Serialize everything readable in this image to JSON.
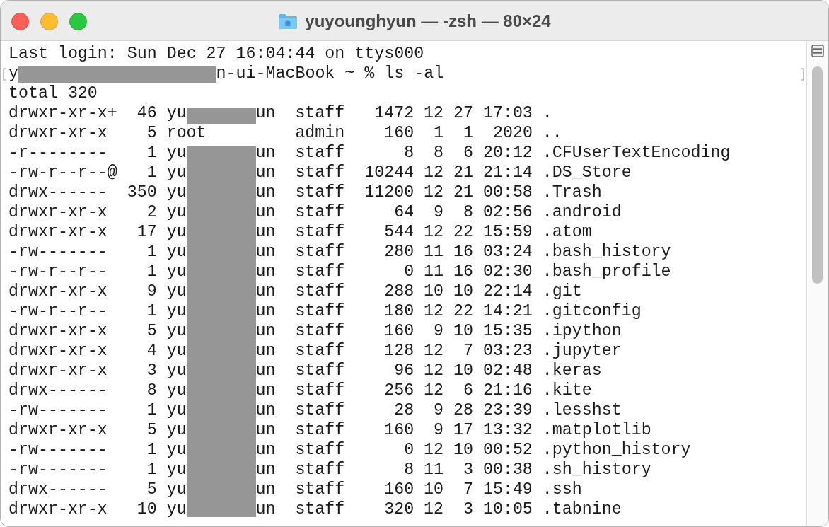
{
  "window": {
    "title": "yuyounghyun — -zsh — 80×24"
  },
  "terminal": {
    "lines": [
      {
        "kind": "text",
        "text": "Last login: Sun Dec 27 16:04:44 on ttys000"
      },
      {
        "kind": "prompt",
        "head": "y",
        "tail": "n-ui-MacBook ~ % ls -al"
      },
      {
        "kind": "text",
        "text": "total 320"
      }
    ],
    "listing": [
      {
        "perms": "drwxr-xr-x+",
        "links": "46",
        "owner_head": "yu",
        "owner_tail": "un",
        "group": "staff",
        "size": "1472",
        "month": "12",
        "day": "27",
        "time": "17:03",
        "name": "."
      },
      {
        "perms": "drwxr-xr-x",
        "links": "5",
        "owner": "root",
        "group": "admin",
        "size": "160",
        "month": "1",
        "day": "1",
        "time": "2020",
        "name": ".."
      },
      {
        "perms": "-r--------",
        "links": "1",
        "owner_head": "yu",
        "owner_tail": "un",
        "group": "staff",
        "size": "8",
        "month": "8",
        "day": "6",
        "time": "20:12",
        "name": ".CFUserTextEncoding"
      },
      {
        "perms": "-rw-r--r--@",
        "links": "1",
        "owner_head": "yu",
        "owner_tail": "un",
        "group": "staff",
        "size": "10244",
        "month": "12",
        "day": "21",
        "time": "21:14",
        "name": ".DS_Store"
      },
      {
        "perms": "drwx------",
        "links": "350",
        "owner_head": "yu",
        "owner_tail": "un",
        "group": "staff",
        "size": "11200",
        "month": "12",
        "day": "21",
        "time": "00:58",
        "name": ".Trash"
      },
      {
        "perms": "drwxr-xr-x",
        "links": "2",
        "owner_head": "yu",
        "owner_tail": "un",
        "group": "staff",
        "size": "64",
        "month": "9",
        "day": "8",
        "time": "02:56",
        "name": ".android"
      },
      {
        "perms": "drwxr-xr-x",
        "links": "17",
        "owner_head": "yu",
        "owner_tail": "un",
        "group": "staff",
        "size": "544",
        "month": "12",
        "day": "22",
        "time": "15:59",
        "name": ".atom"
      },
      {
        "perms": "-rw-------",
        "links": "1",
        "owner_head": "yu",
        "owner_tail": "un",
        "group": "staff",
        "size": "280",
        "month": "11",
        "day": "16",
        "time": "03:24",
        "name": ".bash_history"
      },
      {
        "perms": "-rw-r--r--",
        "links": "1",
        "owner_head": "yu",
        "owner_tail": "un",
        "group": "staff",
        "size": "0",
        "month": "11",
        "day": "16",
        "time": "02:30",
        "name": ".bash_profile"
      },
      {
        "perms": "drwxr-xr-x",
        "links": "9",
        "owner_head": "yu",
        "owner_tail": "un",
        "group": "staff",
        "size": "288",
        "month": "10",
        "day": "10",
        "time": "22:14",
        "name": ".git"
      },
      {
        "perms": "-rw-r--r--",
        "links": "1",
        "owner_head": "yu",
        "owner_tail": "un",
        "group": "staff",
        "size": "180",
        "month": "12",
        "day": "22",
        "time": "14:21",
        "name": ".gitconfig"
      },
      {
        "perms": "drwxr-xr-x",
        "links": "5",
        "owner_head": "yu",
        "owner_tail": "un",
        "group": "staff",
        "size": "160",
        "month": "9",
        "day": "10",
        "time": "15:35",
        "name": ".ipython"
      },
      {
        "perms": "drwxr-xr-x",
        "links": "4",
        "owner_head": "yu",
        "owner_tail": "un",
        "group": "staff",
        "size": "128",
        "month": "12",
        "day": "7",
        "time": "03:23",
        "name": ".jupyter"
      },
      {
        "perms": "drwxr-xr-x",
        "links": "3",
        "owner_head": "yu",
        "owner_tail": "un",
        "group": "staff",
        "size": "96",
        "month": "12",
        "day": "10",
        "time": "02:48",
        "name": ".keras"
      },
      {
        "perms": "drwx------",
        "links": "8",
        "owner_head": "yu",
        "owner_tail": "un",
        "group": "staff",
        "size": "256",
        "month": "12",
        "day": "6",
        "time": "21:16",
        "name": ".kite"
      },
      {
        "perms": "-rw-------",
        "links": "1",
        "owner_head": "yu",
        "owner_tail": "un",
        "group": "staff",
        "size": "28",
        "month": "9",
        "day": "28",
        "time": "23:39",
        "name": ".lesshst"
      },
      {
        "perms": "drwxr-xr-x",
        "links": "5",
        "owner_head": "yu",
        "owner_tail": "un",
        "group": "staff",
        "size": "160",
        "month": "9",
        "day": "17",
        "time": "13:32",
        "name": ".matplotlib"
      },
      {
        "perms": "-rw-------",
        "links": "1",
        "owner_head": "yu",
        "owner_tail": "un",
        "group": "staff",
        "size": "0",
        "month": "12",
        "day": "10",
        "time": "00:52",
        "name": ".python_history"
      },
      {
        "perms": "-rw-------",
        "links": "1",
        "owner_head": "yu",
        "owner_tail": "un",
        "group": "staff",
        "size": "8",
        "month": "11",
        "day": "3",
        "time": "00:38",
        "name": ".sh_history"
      },
      {
        "perms": "drwx------",
        "links": "5",
        "owner_head": "yu",
        "owner_tail": "un",
        "group": "staff",
        "size": "160",
        "month": "10",
        "day": "7",
        "time": "15:49",
        "name": ".ssh"
      },
      {
        "perms": "drwxr-xr-x",
        "links": "10",
        "owner_head": "yu",
        "owner_tail": "un",
        "group": "staff",
        "size": "320",
        "month": "12",
        "day": "3",
        "time": "10:05",
        "name": ".tabnine"
      }
    ]
  }
}
